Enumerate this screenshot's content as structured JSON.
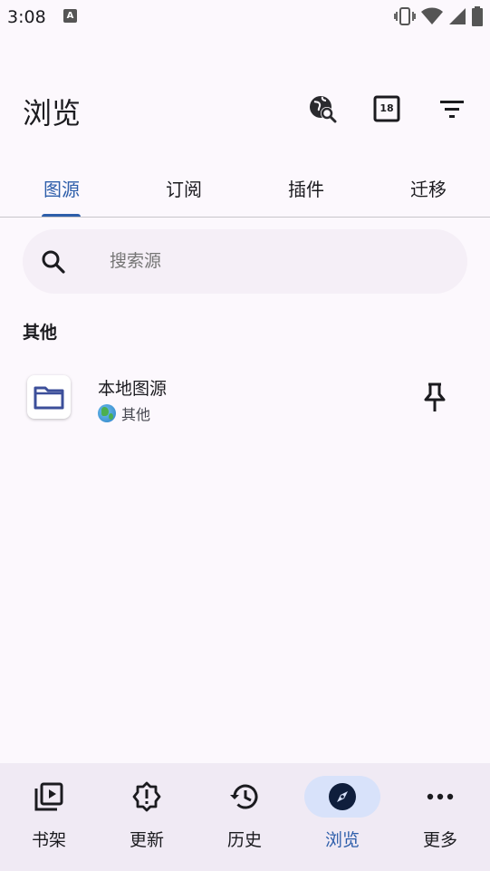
{
  "status_bar": {
    "time": "3:08",
    "notification_letter": "A",
    "icons": [
      "vibrate-icon",
      "wifi-icon",
      "signal-icon",
      "battery-icon"
    ]
  },
  "app_bar": {
    "title": "浏览",
    "actions": [
      "globe-search-icon",
      "adult-content-18-icon",
      "filter-icon"
    ],
    "badge_text": "18"
  },
  "tabs": [
    {
      "label": "图源",
      "active": true
    },
    {
      "label": "订阅",
      "active": false
    },
    {
      "label": "插件",
      "active": false
    },
    {
      "label": "迁移",
      "active": false
    }
  ],
  "search": {
    "placeholder": "搜索源"
  },
  "section": {
    "title": "其他"
  },
  "sources": [
    {
      "name": "本地图源",
      "language": "其他",
      "icon": "folder-icon",
      "lang_icon": "globe-icon",
      "action_icon": "pin-icon"
    }
  ],
  "bottom_nav": [
    {
      "label": "书架",
      "icon": "library-icon",
      "active": false
    },
    {
      "label": "更新",
      "icon": "alert-badge-icon",
      "active": false
    },
    {
      "label": "历史",
      "icon": "history-icon",
      "active": false
    },
    {
      "label": "浏览",
      "icon": "compass-icon",
      "active": true
    },
    {
      "label": "更多",
      "icon": "more-horizontal-icon",
      "active": false
    }
  ],
  "colors": {
    "background": "#fcf8fd",
    "accent": "#2d5eaa",
    "nav_background": "#f0eaf4",
    "nav_active_pill": "#d8e2fa",
    "search_background": "#f5eff7"
  }
}
